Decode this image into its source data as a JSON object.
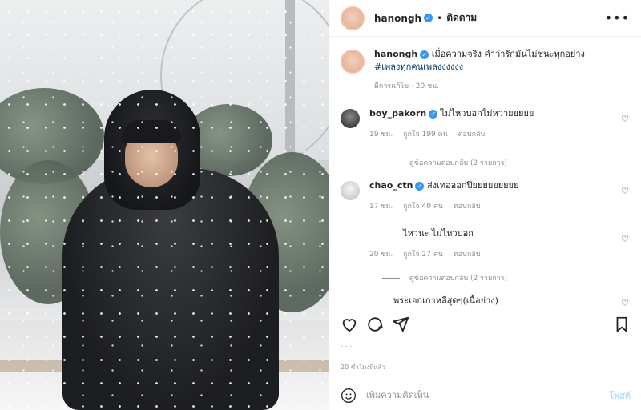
{
  "post": {
    "username": "hanongh",
    "follow_label": "ติดตาม",
    "dot": "•",
    "more_icon": "more-horizontal-icon"
  },
  "caption": {
    "username": "hanongh",
    "text": "เมื่อความจริง คำว่ารักมันไม่ชนะทุกอย่าง",
    "hashtag": "#เพลงทุกคนเพลงงงงงง",
    "edited": "มีการแก้ไข · 20 ชม."
  },
  "comments": [
    {
      "username": "boy_pakorn",
      "verified": true,
      "text": "ไม่ไหวบอกไม่หวายยยยย",
      "time": "19 ชม.",
      "likes": "ถูกใจ 199 คน",
      "reply": "ตอบกลับ",
      "view_replies": "ดูข้อความตอบกลับ (2 รายการ)"
    },
    {
      "username": "chao_ctn",
      "verified": true,
      "text": "ส่งเทอออกปียยยยยยยยย",
      "time": "17 ชม.",
      "likes": "ถูกใจ 40 คน",
      "reply": "ตอบกลับ"
    },
    {
      "username": "",
      "text": "ไหวนะ ไม่ไหวบอก",
      "time": "20 ชม.",
      "likes": "ถูกใจ 27 คน",
      "reply": "ตอบกลับ",
      "view_replies": "ดูข้อความตอบกลับ (2 รายการ)"
    },
    {
      "username": "",
      "text": "พระเอกเกาหลีสุดๆ(เนื้อย่าง)"
    }
  ],
  "likes_text": ". . .",
  "timestamp": "20 ชั่วโมงที่แล้ว",
  "comment_input": {
    "placeholder": "เพิ่มความคิดเห็น",
    "post_label": "โพสต์"
  },
  "colors": {
    "link": "#00376b",
    "verified": "#3897f0",
    "muted": "#8e8e8e",
    "post_button": "#b2dffc"
  }
}
